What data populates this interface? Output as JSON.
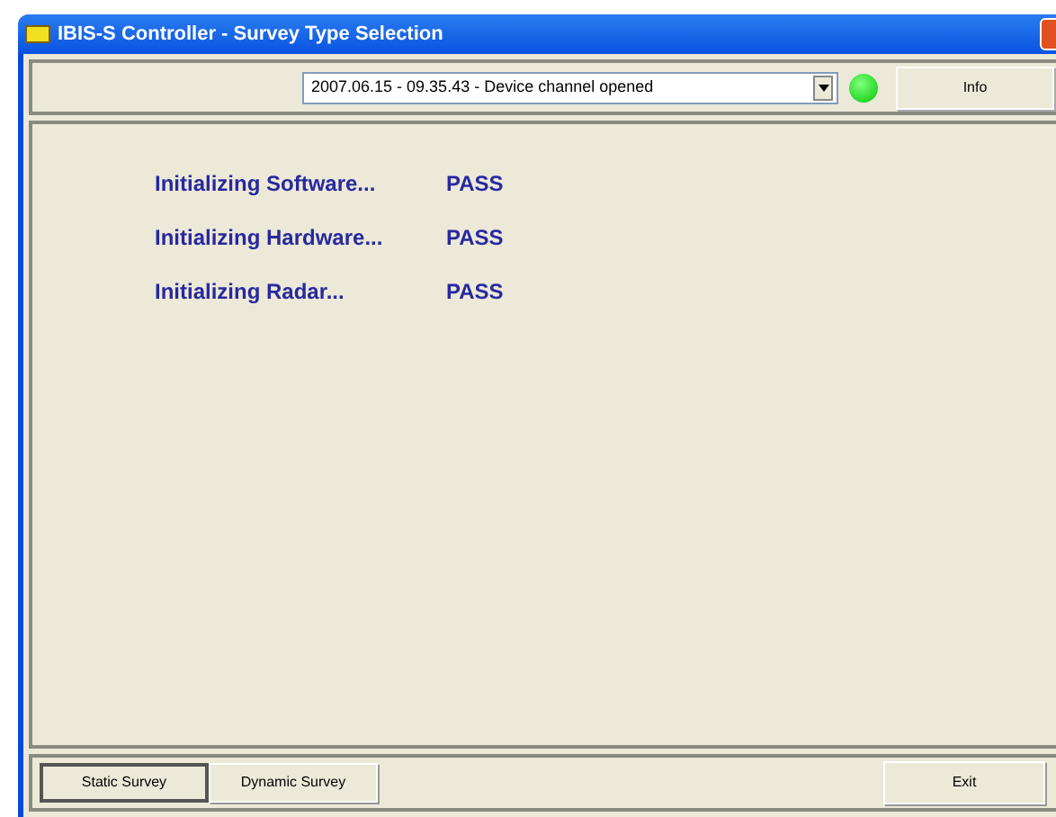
{
  "window": {
    "title": "IBIS-S Controller - Survey Type Selection"
  },
  "toolbar": {
    "log_value": "2007.06.15 - 09.35.43 - Device channel opened",
    "info_button": "Info"
  },
  "checks": [
    {
      "label": "Initializing Software...",
      "result": "PASS"
    },
    {
      "label": "Initializing Hardware...",
      "result": "PASS"
    },
    {
      "label": "Initializing Radar...",
      "result": "PASS"
    }
  ],
  "buttons": [
    {
      "label": "Static Survey",
      "focused": true
    },
    {
      "label": "Dynamic Survey",
      "focused": false
    }
  ],
  "exit_button": "Exit"
}
